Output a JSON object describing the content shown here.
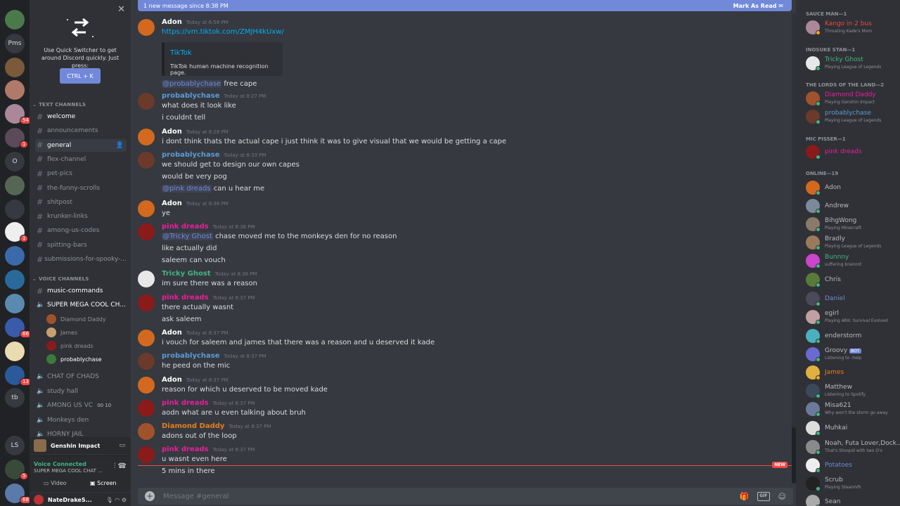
{
  "rail": {
    "servers": [
      {
        "label": "",
        "color": "#4a7a4a",
        "badge": ""
      },
      {
        "label": "Pms",
        "color": "#36393f",
        "badge": ""
      },
      {
        "label": "",
        "color": "#7a5a3a",
        "badge": ""
      },
      {
        "label": "",
        "color": "#b07a6a",
        "badge": ""
      },
      {
        "label": "",
        "color": "#aa8899",
        "badge": "54"
      },
      {
        "label": "",
        "color": "#5a4a5a",
        "badge": "1"
      },
      {
        "label": "O",
        "color": "#36393f",
        "badge": ""
      },
      {
        "label": "",
        "color": "#556655",
        "badge": ""
      },
      {
        "label": "",
        "color": "#36393f",
        "badge": ""
      },
      {
        "label": "",
        "color": "#eeeeee",
        "badge": "1"
      },
      {
        "label": "",
        "color": "#3a6aaa",
        "badge": ""
      },
      {
        "label": "",
        "color": "#2a6a9a",
        "badge": ""
      },
      {
        "label": "",
        "color": "#5a8ab0",
        "badge": ""
      },
      {
        "label": "",
        "color": "#3a5aaa",
        "badge": "66"
      },
      {
        "label": "",
        "color": "#e8dcb0",
        "badge": ""
      },
      {
        "label": "",
        "color": "#2a5a9a",
        "badge": "13"
      },
      {
        "label": "tb",
        "color": "#36393f",
        "badge": ""
      },
      {
        "label": "",
        "color": "#202225",
        "badge": ""
      },
      {
        "label": "LS",
        "color": "#36393f",
        "badge": ""
      },
      {
        "label": "",
        "color": "#3a4a3a",
        "badge": "5"
      },
      {
        "label": "",
        "color": "#5a7aaa",
        "badge": "68"
      }
    ]
  },
  "quick_switcher": {
    "text": "Use Quick Switcher to get around Discord quickly. Just press:",
    "button": "CTRL + K"
  },
  "sidebar": {
    "text_category": "TEXT CHANNELS",
    "voice_category": "VOICE CHANNELS",
    "text_channels": [
      {
        "name": "welcome",
        "state": "bold"
      },
      {
        "name": "announcements",
        "state": ""
      },
      {
        "name": "general",
        "state": "active"
      },
      {
        "name": "flex-channel",
        "state": ""
      },
      {
        "name": "pet-pics",
        "state": ""
      },
      {
        "name": "the-funny-scrolls",
        "state": ""
      },
      {
        "name": "shitpost",
        "state": ""
      },
      {
        "name": "krunker-links",
        "state": ""
      },
      {
        "name": "among-us-codes",
        "state": ""
      },
      {
        "name": "spitting-bars",
        "state": ""
      },
      {
        "name": "submissions-for-spooky-...",
        "state": ""
      }
    ],
    "music_channel": "music-commands",
    "voice_channel_active": "SUPER MEGA COOL CH...",
    "voice_users": [
      {
        "name": "Diamond Daddy",
        "color": "#a0522d"
      },
      {
        "name": "James",
        "color": "#c8a070"
      },
      {
        "name": "pink dreads",
        "color": "#8b1a1a"
      },
      {
        "name": "probablychase",
        "color": "#3a7a3a"
      }
    ],
    "voice_channels": [
      {
        "name": "CHAT OF CHADS",
        "counts": ""
      },
      {
        "name": "study hall",
        "counts": ""
      },
      {
        "name": "AMONG US VC",
        "counts": "00  10"
      },
      {
        "name": "Monkeys den",
        "counts": ""
      },
      {
        "name": "HORNY JAIL",
        "counts": ""
      }
    ],
    "game": "Genshin Impact",
    "voice_status": "Voice Connected",
    "voice_channel_line": "SUPER MEGA COOL CHAT ...",
    "video_label": "Video",
    "screen_label": "Screen",
    "username": "NateDrakeS..."
  },
  "chat": {
    "new_bar": "1 new message since 8:38 PM",
    "mark_read": "Mark As Read",
    "embed_title": "TikTok",
    "embed_desc": "TikTok human machine recognition page.",
    "new_tag": "NEW",
    "composer_placeholder": "Message #general",
    "messages": [
      {
        "author": "Adon",
        "color": "#ffffff",
        "time": "Today at 6:58 PM",
        "avatar": "#d2691e",
        "lines": [
          "https://vm.tiktok.com/ZMJH4kUxw/"
        ]
      },
      {
        "author": "",
        "color": "",
        "time": "",
        "avatar": "",
        "lines": [
          "@probablychase free cape"
        ]
      },
      {
        "author": "probablychase",
        "color": "#5b9bd5",
        "time": "Today at 8:27 PM",
        "avatar": "#6b3a2a",
        "lines": [
          "what does it look like",
          "i couldnt tell"
        ]
      },
      {
        "author": "Adon",
        "color": "#ffffff",
        "time": "Today at 8:28 PM",
        "avatar": "#d2691e",
        "lines": [
          "i dont think thats the actual cape i just think it was to give visual that we would be getting a cape"
        ]
      },
      {
        "author": "probablychase",
        "color": "#5b9bd5",
        "time": "Today at 8:33 PM",
        "avatar": "#6b3a2a",
        "lines": [
          "we should get to design our own capes",
          "would be very pog",
          "@pink dreads can u hear me"
        ]
      },
      {
        "author": "Adon",
        "color": "#ffffff",
        "time": "Today at 8:36 PM",
        "avatar": "#d2691e",
        "lines": [
          "ye"
        ]
      },
      {
        "author": "pink dreads",
        "color": "#e91e9c",
        "time": "Today at 8:36 PM",
        "avatar": "#8b1a1a",
        "lines": [
          "@Tricky Ghost chase moved me to the monkeys den for no reason",
          "like actually did",
          "saleem can vouch"
        ]
      },
      {
        "author": "Tricky Ghost",
        "color": "#43b581",
        "time": "Today at 8:36 PM",
        "avatar": "#e8e8e8",
        "lines": [
          "im sure there was a reason"
        ]
      },
      {
        "author": "pink dreads",
        "color": "#e91e9c",
        "time": "Today at 8:37 PM",
        "avatar": "#8b1a1a",
        "lines": [
          "there actually wasnt",
          "ask saleem"
        ]
      },
      {
        "author": "Adon",
        "color": "#ffffff",
        "time": "Today at 8:37 PM",
        "avatar": "#d2691e",
        "lines": [
          "i vouch for saleem and james that there was a reason and u deserved it kade"
        ]
      },
      {
        "author": "probablychase",
        "color": "#5b9bd5",
        "time": "Today at 8:37 PM",
        "avatar": "#6b3a2a",
        "lines": [
          "he peed on the mic"
        ]
      },
      {
        "author": "Adon",
        "color": "#ffffff",
        "time": "Today at 8:37 PM",
        "avatar": "#d2691e",
        "lines": [
          "reason for which u deserved to be moved kade"
        ]
      },
      {
        "author": "pink dreads",
        "color": "#e91e9c",
        "time": "Today at 8:37 PM",
        "avatar": "#8b1a1a",
        "lines": [
          "aodn what are u even talking about bruh"
        ]
      },
      {
        "author": "Diamond Daddy",
        "color": "#e67e22",
        "time": "Today at 8:37 PM",
        "avatar": "#a0522d",
        "lines": [
          "adons out of the loop"
        ]
      },
      {
        "author": "pink dreads",
        "color": "#e91e9c",
        "time": "Today at 8:37 PM",
        "avatar": "#8b1a1a",
        "lines": [
          "u wasnt even here",
          "5 mins in there"
        ]
      }
    ]
  },
  "members": {
    "roles": [
      "SAUCE MAN—1",
      "INOSUKE STAN—1",
      "THE LORDS OF THE LAND—2",
      "MIC PISSER—1",
      "ONLINE—19"
    ],
    "list": [
      {
        "name": "Kango in 2 bus",
        "sub": "Throating Kade's Mom",
        "color": "#e74c3c",
        "avatar": "#aa8899"
      },
      {
        "name": "Tricky Ghost",
        "sub": "Playing League of Legends",
        "color": "#43b581",
        "avatar": "#e8e8e8"
      },
      {
        "name": "Diamond Daddy",
        "sub": "Playing Genshin Impact",
        "color": "#e91e9c",
        "avatar": "#a0522d"
      },
      {
        "name": "probablychase",
        "sub": "Playing League of Legends",
        "color": "#5b9bd5",
        "avatar": "#6b3a2a"
      },
      {
        "name": "pink dreads",
        "sub": "",
        "color": "#e91e9c",
        "avatar": "#8b1a1a"
      },
      {
        "name": "Adon",
        "sub": "",
        "color": "#b9bbbe",
        "avatar": "#d2691e"
      },
      {
        "name": "Andrew",
        "sub": "",
        "color": "#b9bbbe",
        "avatar": "#7a8a9a"
      },
      {
        "name": "BihgWong",
        "sub": "Playing Minecraft",
        "color": "#b9bbbe",
        "avatar": "#8a7a6a"
      },
      {
        "name": "Bradly",
        "sub": "Playing League of Legends",
        "color": "#b9bbbe",
        "avatar": "#9a7a5a"
      },
      {
        "name": "Bunnny",
        "sub": "suffering brainrot",
        "color": "#43b581",
        "avatar": "#cc44cc"
      },
      {
        "name": "Chris",
        "sub": "",
        "color": "#b9bbbe",
        "avatar": "#5a7a3a"
      },
      {
        "name": "Daniel",
        "sub": "",
        "color": "#7289da",
        "avatar": "#4a4a5a"
      },
      {
        "name": "egirl",
        "sub": "Playing ARK: Survival Evolved",
        "color": "#b9bbbe",
        "avatar": "#c0a0a0"
      },
      {
        "name": "enderstorm",
        "sub": "",
        "color": "#b9bbbe",
        "avatar": "#4ab0c0"
      },
      {
        "name": "Groovy",
        "sub": "Listening to -help",
        "color": "#b9bbbe",
        "avatar": "#6a6ad0"
      },
      {
        "name": "James",
        "sub": "",
        "color": "#e67e22",
        "avatar": "#e0b040"
      },
      {
        "name": "Matthew",
        "sub": "Listening to Spotify",
        "color": "#b9bbbe",
        "avatar": "#3a4a5a"
      },
      {
        "name": "Misa621",
        "sub": "Why won't the storm go away",
        "color": "#b9bbbe",
        "avatar": "#6a7a9a"
      },
      {
        "name": "Muhkai",
        "sub": "",
        "color": "#b9bbbe",
        "avatar": "#dddddd"
      },
      {
        "name": "Noah, Futa Lover,Dock...",
        "sub": "That's Stoopid with two O's",
        "color": "#b9bbbe",
        "avatar": "#8a8a8a"
      },
      {
        "name": "Potatoes",
        "sub": "",
        "color": "#7289da",
        "avatar": "#eeeeee"
      },
      {
        "name": "Scrub",
        "sub": "Playing SteamVR",
        "color": "#b9bbbe",
        "avatar": "#222222"
      },
      {
        "name": "Sean",
        "sub": "",
        "color": "#b9bbbe",
        "avatar": "#aaaaaa"
      }
    ],
    "bot_tag": "BOT"
  }
}
